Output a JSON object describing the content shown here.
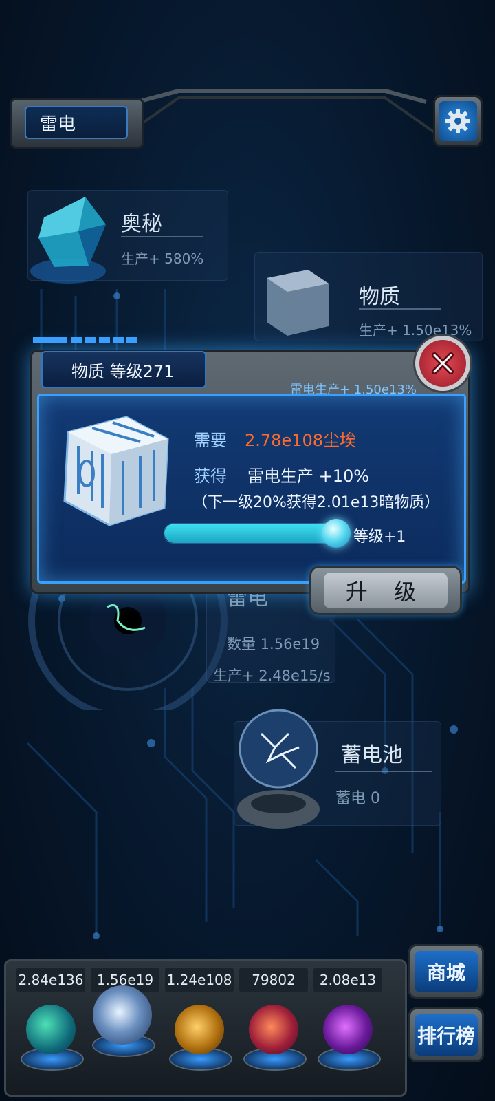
{
  "header": {
    "title": "雷电",
    "settings_icon": "gear-icon"
  },
  "nodes": {
    "aomi": {
      "name": "奥秘",
      "stat": "生产+ 580%"
    },
    "wuzhi": {
      "name": "物质",
      "stat": "生产+ 1.50e13%"
    },
    "leidian": {
      "name": "雷电",
      "count": "数量 1.56e19",
      "stat": "生产+ 2.48e15/s"
    },
    "battery": {
      "name": "蓄电池",
      "stat": "蓄电 0"
    }
  },
  "dialog": {
    "title": "物质 等级271",
    "subtitle": "雷电生产+ 1.50e13%",
    "need_label": "需要",
    "need_value": "2.78e108尘埃",
    "gain_label": "获得",
    "gain_value": "雷电生产 +10%",
    "next_note": "（下一级20%获得2.01e13暗物质）",
    "level_increment": "等级+1",
    "slider_fraction": 1.0,
    "upgrade_label": "升 级",
    "close_icon": "close-icon"
  },
  "bottom": {
    "resources": [
      "2.84e136",
      "1.56e19",
      "1.24e108",
      "79802",
      "2.08e13"
    ],
    "shop_label": "商城",
    "rank_label": "排行榜"
  },
  "colors": {
    "accent_blue": "#3aa0ff",
    "cost_orange": "#ff6a2e",
    "slider_cyan": "#3fe0f0"
  }
}
